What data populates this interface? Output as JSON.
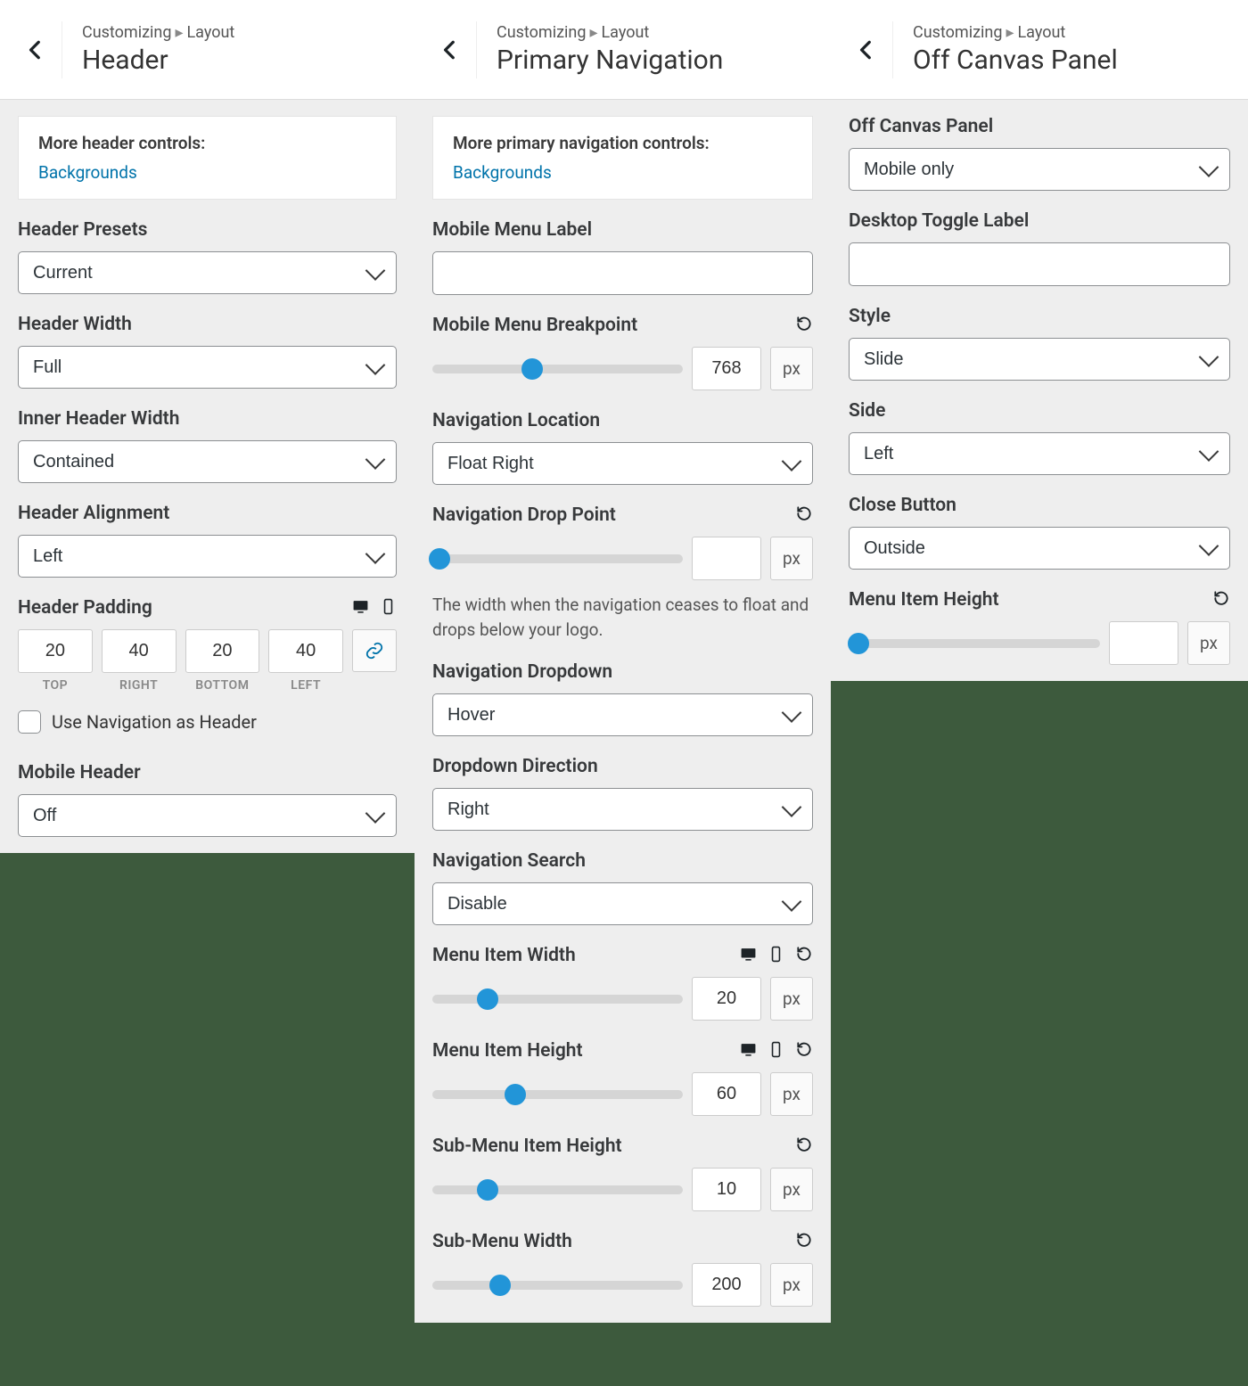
{
  "breadcrumb": {
    "root": "Customizing",
    "section": "Layout"
  },
  "unit_px": "px",
  "panel1": {
    "title": "Header",
    "info_title": "More header controls:",
    "info_link": "Backgrounds",
    "header_presets": {
      "label": "Header Presets",
      "value": "Current"
    },
    "header_width": {
      "label": "Header Width",
      "value": "Full"
    },
    "inner_header_width": {
      "label": "Inner Header Width",
      "value": "Contained"
    },
    "header_alignment": {
      "label": "Header Alignment",
      "value": "Left"
    },
    "header_padding": {
      "label": "Header Padding",
      "top": "20",
      "right": "40",
      "bottom": "20",
      "left": "40",
      "top_label": "TOP",
      "right_label": "RIGHT",
      "bottom_label": "BOTTOM",
      "left_label": "LEFT"
    },
    "use_nav_as_header": "Use Navigation as Header",
    "mobile_header": {
      "label": "Mobile Header",
      "value": "Off"
    }
  },
  "panel2": {
    "title": "Primary Navigation",
    "info_title": "More primary navigation controls:",
    "info_link": "Backgrounds",
    "mobile_menu_label": {
      "label": "Mobile Menu Label",
      "value": ""
    },
    "mobile_menu_breakpoint": {
      "label": "Mobile Menu Breakpoint",
      "value": "768",
      "pct": 40
    },
    "nav_location": {
      "label": "Navigation Location",
      "value": "Float Right"
    },
    "nav_drop_point": {
      "label": "Navigation Drop Point",
      "value": "",
      "pct": 3,
      "help": "The width when the navigation ceases to float and drops below your logo."
    },
    "nav_dropdown": {
      "label": "Navigation Dropdown",
      "value": "Hover"
    },
    "dropdown_direction": {
      "label": "Dropdown Direction",
      "value": "Right"
    },
    "nav_search": {
      "label": "Navigation Search",
      "value": "Disable"
    },
    "menu_item_width": {
      "label": "Menu Item Width",
      "value": "20",
      "pct": 22
    },
    "menu_item_height": {
      "label": "Menu Item Height",
      "value": "60",
      "pct": 33
    },
    "submenu_item_height": {
      "label": "Sub-Menu Item Height",
      "value": "10",
      "pct": 22
    },
    "submenu_width": {
      "label": "Sub-Menu Width",
      "value": "200",
      "pct": 27
    }
  },
  "panel3": {
    "title": "Off Canvas Panel",
    "off_canvas_panel": {
      "label": "Off Canvas Panel",
      "value": "Mobile only"
    },
    "desktop_toggle_label": {
      "label": "Desktop Toggle Label",
      "value": ""
    },
    "style": {
      "label": "Style",
      "value": "Slide"
    },
    "side": {
      "label": "Side",
      "value": "Left"
    },
    "close_button": {
      "label": "Close Button",
      "value": "Outside"
    },
    "menu_item_height": {
      "label": "Menu Item Height",
      "value": "",
      "pct": 4
    }
  }
}
